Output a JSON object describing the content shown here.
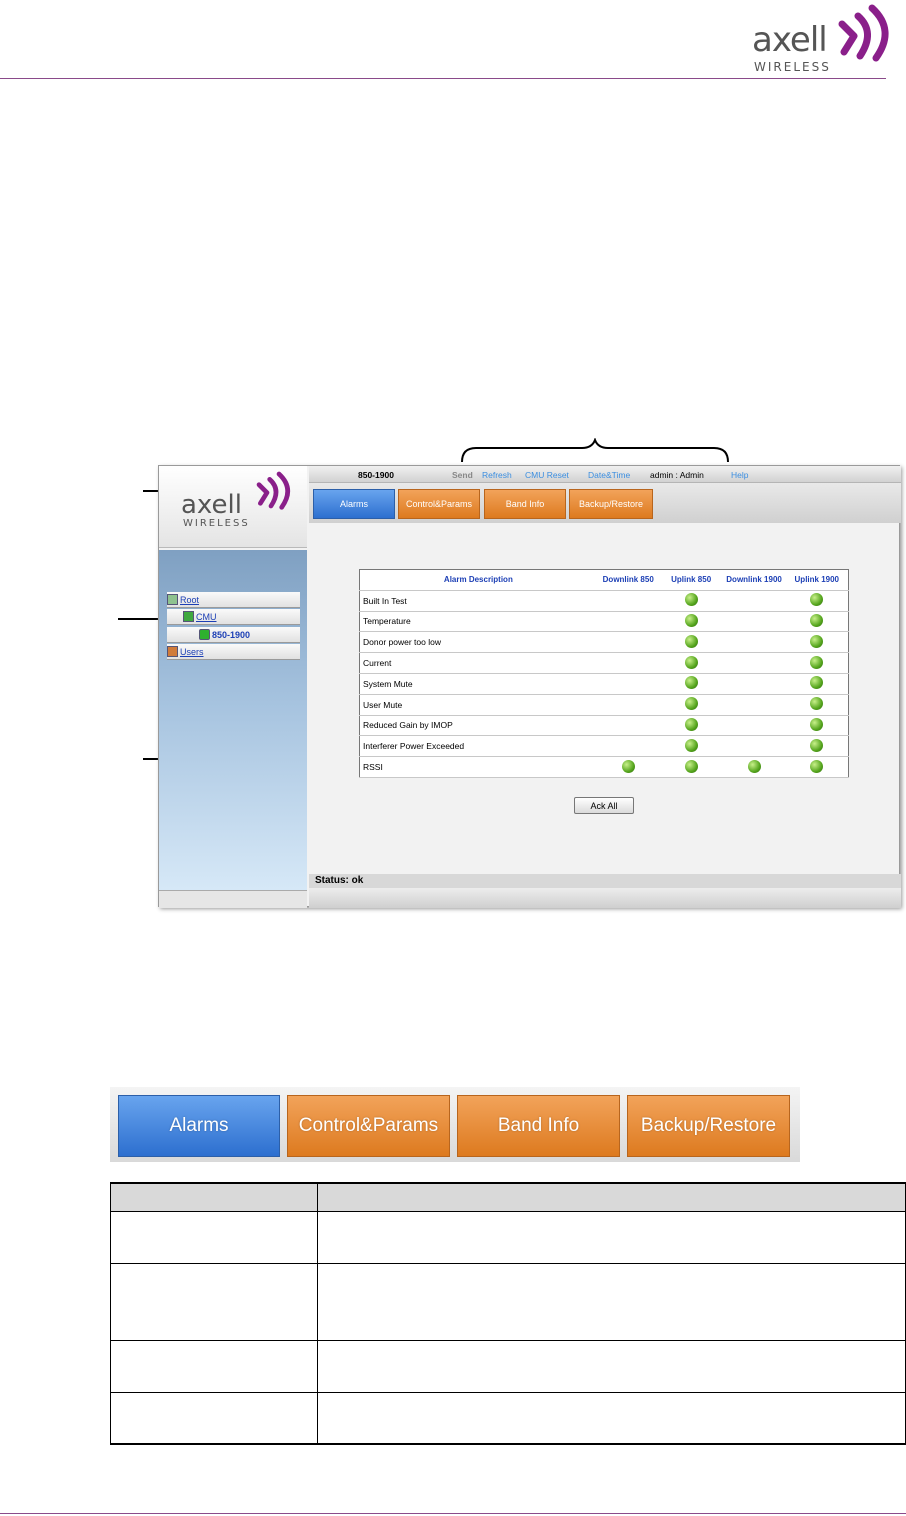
{
  "brand": {
    "name": "axell",
    "sub": "WIRELESS",
    "accent": "#8a1f8a"
  },
  "screenshot": {
    "sidebar_logo": {
      "name": "axell",
      "sub": "WIRELESS"
    },
    "tree": [
      {
        "label": "Root",
        "icon": "root-icon"
      },
      {
        "label": "CMU",
        "icon": "cmu-icon"
      },
      {
        "label": "850-1900",
        "icon": "band-icon"
      },
      {
        "label": "Users",
        "icon": "users-icon"
      }
    ],
    "topbar": {
      "device": "850-1900",
      "send": "Send",
      "refresh": "Refresh",
      "cmu_reset": "CMU Reset",
      "date_time": "Date&Time",
      "user": "admin : Admin",
      "help": "Help"
    },
    "tabs": [
      "Alarms",
      "Control&Params",
      "Band Info",
      "Backup/Restore"
    ],
    "alarm_table": {
      "headers": [
        "Alarm Description",
        "Downlink 850",
        "Uplink 850",
        "Downlink 1900",
        "Uplink 1900"
      ],
      "rows": [
        {
          "label": "Built In Test",
          "leds": [
            false,
            true,
            false,
            true
          ]
        },
        {
          "label": "Temperature",
          "leds": [
            false,
            true,
            false,
            true
          ]
        },
        {
          "label": "Donor power too low",
          "leds": [
            false,
            true,
            false,
            true
          ]
        },
        {
          "label": "Current",
          "leds": [
            false,
            true,
            false,
            true
          ]
        },
        {
          "label": "System Mute",
          "leds": [
            false,
            true,
            false,
            true
          ]
        },
        {
          "label": "User Mute",
          "leds": [
            false,
            true,
            false,
            true
          ]
        },
        {
          "label": "Reduced Gain by IMOP",
          "leds": [
            false,
            true,
            false,
            true
          ]
        },
        {
          "label": "Interferer Power Exceeded",
          "leds": [
            false,
            true,
            false,
            true
          ]
        },
        {
          "label": "RSSI",
          "leds": [
            true,
            true,
            true,
            true
          ]
        }
      ]
    },
    "ack_all": "Ack All",
    "status": "Status: ok"
  },
  "big_tabs": [
    "Alarms",
    "Control&Params",
    "Band Info",
    "Backup/Restore"
  ],
  "colors": {
    "tab_blue": "#3d7fd9",
    "tab_orange": "#e68a2e",
    "led_green": "#55a51d"
  }
}
